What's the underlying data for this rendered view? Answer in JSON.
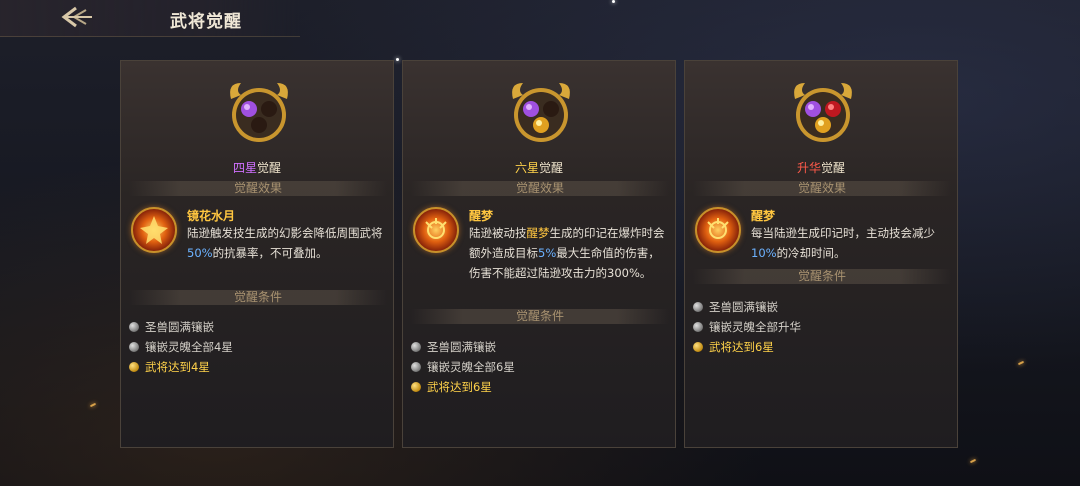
{
  "header": {
    "title": "武将觉醒",
    "back_icon": "back-arrow-icon"
  },
  "colors": {
    "purple": "#d070ff",
    "gold": "#ffd24a",
    "red": "#ff5a4a",
    "blue": "#6cb2ff"
  },
  "cards": [
    {
      "title_highlight": "四星",
      "title_suffix": "觉醒",
      "effect_label": "觉醒效果",
      "skill_name": "镜花水月",
      "desc_parts": [
        "陆逊触发技生成的幻影会降低周围武将",
        "50%",
        "的抗暴率，不可叠加。"
      ],
      "cond_label": "觉醒条件",
      "conditions": [
        "圣兽圆满镶嵌",
        "镶嵌灵魄全部4星",
        "武将达到4星"
      ]
    },
    {
      "title_highlight": "六星",
      "title_suffix": "觉醒",
      "effect_label": "觉醒效果",
      "skill_name": "醒梦",
      "desc_parts": [
        "陆逊被动技",
        "醒梦",
        "生成的印记在爆炸时会额外造成目标",
        "5%",
        "最大生命值的伤害，伤害不能超过陆逊攻击力的300%。"
      ],
      "cond_label": "觉醒条件",
      "conditions": [
        "圣兽圆满镶嵌",
        "镶嵌灵魄全部6星",
        "武将达到6星"
      ]
    },
    {
      "title_highlight": "升华",
      "title_suffix": "觉醒",
      "effect_label": "觉醒效果",
      "skill_name": "醒梦",
      "desc_parts": [
        "每当陆逊生成印记时，主动技会减少",
        "10%",
        "的冷却时间。"
      ],
      "cond_label": "觉醒条件",
      "conditions": [
        "圣兽圆满镶嵌",
        "镶嵌灵魄全部升华",
        "武将达到6星"
      ]
    }
  ]
}
